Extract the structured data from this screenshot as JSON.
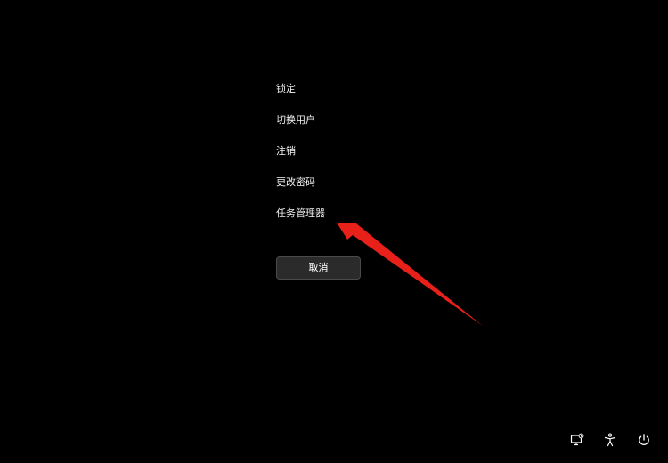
{
  "menu": {
    "items": [
      {
        "label": "锁定"
      },
      {
        "label": "切换用户"
      },
      {
        "label": "注销"
      },
      {
        "label": "更改密码"
      },
      {
        "label": "任务管理器"
      }
    ]
  },
  "cancel": {
    "label": "取消"
  },
  "annotation": {
    "color": "#e8201a",
    "points_to": "任务管理器"
  },
  "tray": {
    "icons": [
      "network-icon",
      "accessibility-icon",
      "power-icon"
    ]
  },
  "colors": {
    "background": "#000000",
    "text": "#f2f2f2",
    "button_bg": "#2b2b2b"
  }
}
